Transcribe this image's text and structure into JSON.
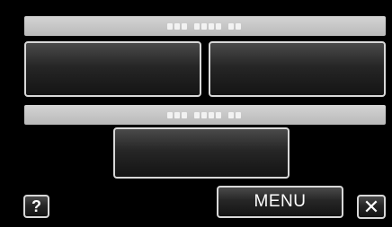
{
  "title_bar_top": {
    "text": ""
  },
  "option_buttons": [
    {
      "label": ""
    },
    {
      "label": ""
    },
    {
      "label": ""
    }
  ],
  "title_bar_middle": {
    "text": ""
  },
  "footer": {
    "help_label": "?",
    "menu_label": "MENU",
    "close_label": "✕"
  }
}
